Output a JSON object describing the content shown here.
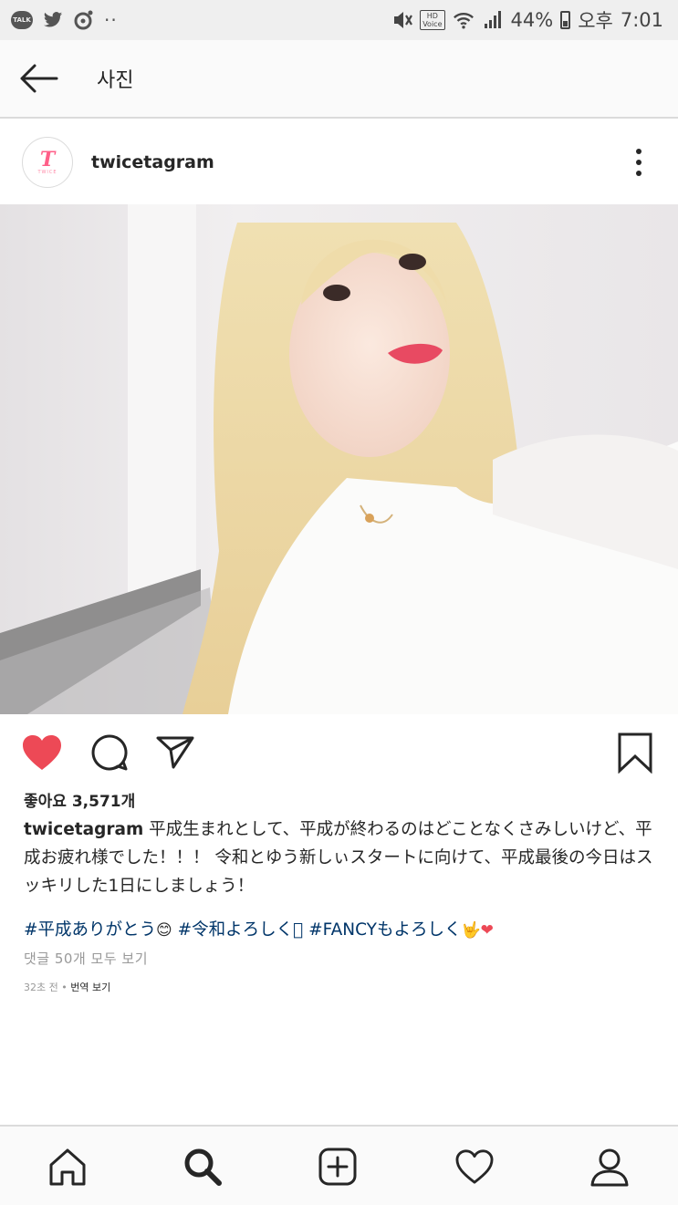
{
  "status_bar": {
    "talk_icon_text": "TALK",
    "battery_percent": "44%",
    "period": "오후",
    "time": "7:01",
    "hd_label": "HD",
    "voice_label": "Voice"
  },
  "nav": {
    "title": "사진"
  },
  "post": {
    "username": "twicetagram",
    "avatar_letter": "T",
    "avatar_sub": "TWICE",
    "likes": "좋아요 3,571개",
    "caption_user": "twicetagram",
    "caption_text": " 平成生まれとして、平成が終わるのはどことなくさみしいけど、平成お疲れ様でした！！！ 令和とゆう新しぃスタートに向けて、平成最後の今日はスッキリした1日にしましょう！",
    "tag1": "#平成ありがとう",
    "emoji1": "😊",
    "tag2": " #令和よろしく",
    "tag2_glyph": "󾠛",
    "tag3": " #FANCYもよろしく",
    "emoji2": "🤟",
    "emoji3": "❤",
    "comments_link": "댓글 50개 모두 보기",
    "time_ago": "32초 전 • ",
    "translate": "번역 보기"
  },
  "colors": {
    "heart": "#ed4956",
    "hashtag": "#003569",
    "text": "#262626",
    "muted": "#999999"
  },
  "icons": {
    "back": "arrow-left-icon",
    "more": "more-vertical-icon",
    "like": "heart-filled-icon",
    "comment": "comment-icon",
    "share": "direct-share-icon",
    "save": "bookmark-icon",
    "home": "home-icon",
    "search": "search-icon",
    "add": "add-post-icon",
    "activity": "heart-outline-icon",
    "profile": "profile-icon"
  }
}
